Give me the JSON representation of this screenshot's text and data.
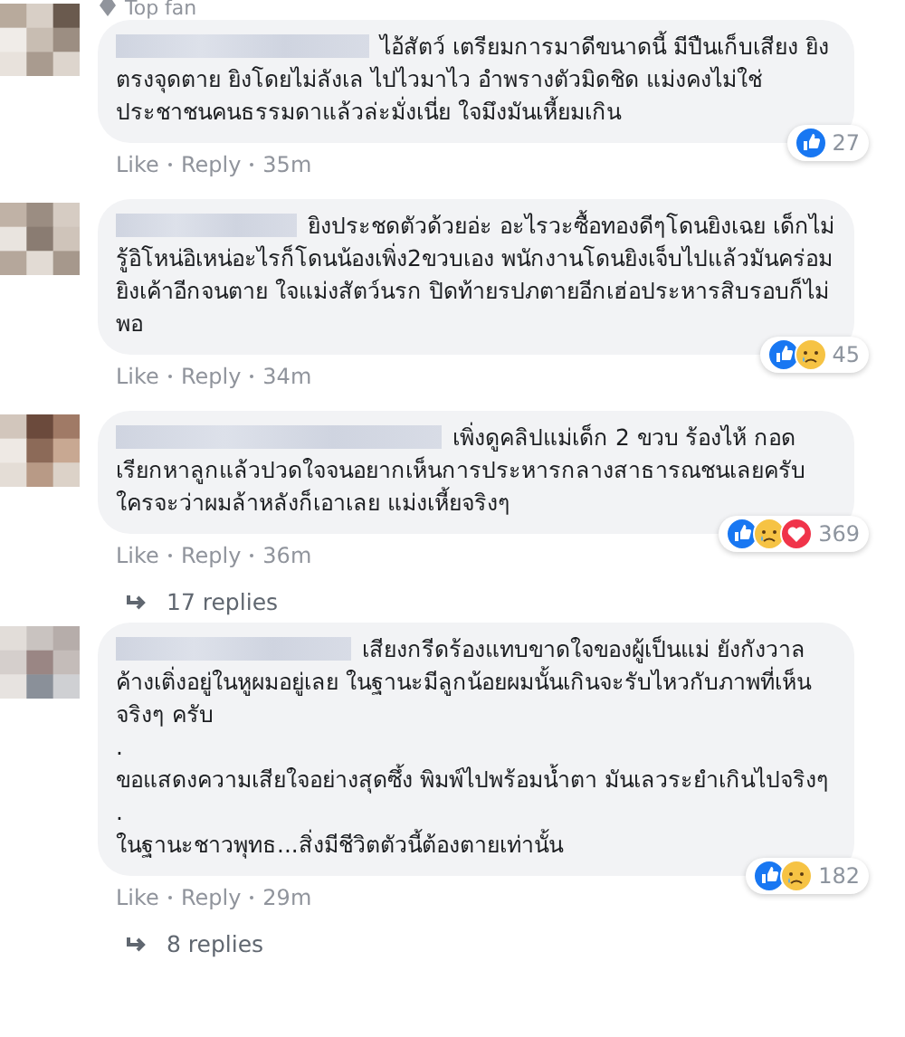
{
  "comments": [
    {
      "badge": "Top fan",
      "text": "ไอ้สัตว์ เตรียมการมาดีขนาดนี้ มีปืนเก็บเสียง ยิงตรงจุดตาย ยิงโดยไม่ลังเล ไปไวมาไว อำพรางตัวมิดชิด แม่งคงไม่ใช่ประชาชนคนธรรมดาแล้วล่ะมั่งเนี่ย ใจมึงมันเหี้ยมเกิน",
      "reactions": [
        {
          "kind": "like"
        }
      ],
      "reaction_count": "27",
      "like": "Like",
      "reply": "Reply",
      "time": "35m"
    },
    {
      "text": "ยิงประชดตัวด้วยอ่ะ อะไรวะซื้อทองดีๆโดนยิงเฉย เด็กไม่รู้อิโหน่อิเหน่อะไรก็โดนน้องเพิ่ง2ขวบเอง พนักงานโดนยิงเจ็บไปแล้วมันคร่อมยิงเค้าอีกจนตาย ใจแม่งสัตว์นรก ปิดท้ายรปภตายอีกเฮ่อประหารสิบรอบก็ไม่พอ",
      "reactions": [
        {
          "kind": "like"
        },
        {
          "kind": "sad"
        }
      ],
      "reaction_count": "45",
      "like": "Like",
      "reply": "Reply",
      "time": "34m"
    },
    {
      "text": "เพิ่งดูคลิปแม่เด็ก 2 ขวบ ร้องไห้ กอด เรียกหาลูกแล้วปวดใจจนอยากเห็นการประหารกลางสาธารณชนเลยครับ ใครจะว่าผมล้าหลังก็เอาเลย แม่งเหี้ยจริงๆ",
      "reactions": [
        {
          "kind": "like"
        },
        {
          "kind": "sad"
        },
        {
          "kind": "love"
        }
      ],
      "reaction_count": "369",
      "like": "Like",
      "reply": "Reply",
      "time": "36m",
      "replies": "17 replies"
    },
    {
      "text": "เสียงกรีดร้องแทบขาดใจของผู้เป็นแม่ ยังกังวาลค้างเติ่งอยู่ในหูผมอยู่เลย ในฐานะมีลูกน้อยผมนั้นเกินจะรับไหวกับภาพที่เห็นจริงๆ ครับ\n.\nขอแสดงความเสียใจอย่างสุดซึ้ง พิมพ์ไปพร้อมน้ำตา มันเลวระยำเกินไปจริงๆ\n.\nในฐานะชาวพุทธ...สิ่งมีชีวิตตัวนี้ต้องตายเท่านั้น",
      "reactions": [
        {
          "kind": "like"
        },
        {
          "kind": "sad"
        }
      ],
      "reaction_count": "182",
      "like": "Like",
      "reply": "Reply",
      "time": "29m",
      "replies": "8 replies"
    }
  ]
}
